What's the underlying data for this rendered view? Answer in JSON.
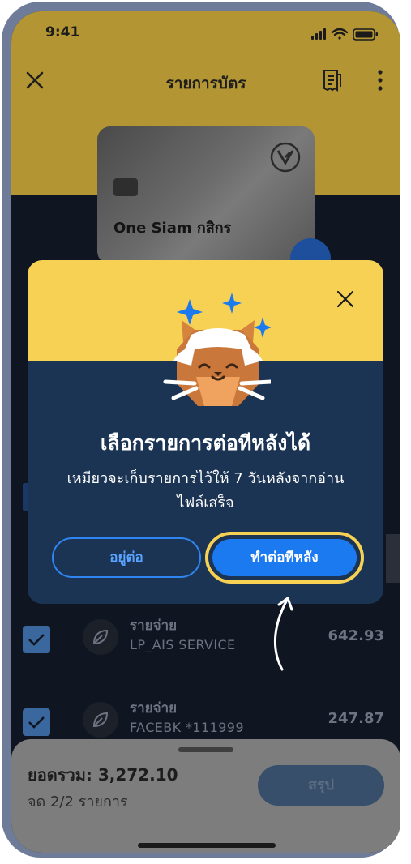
{
  "status_bar": {
    "time": "9:41"
  },
  "header": {
    "title": "รายการบัตร"
  },
  "card": {
    "name": "One Siam กสิกร"
  },
  "transactions": [
    {
      "type": "รายจ่าย",
      "merchant": "LP_AIS SERVICE",
      "amount": "642.93",
      "checked": true
    },
    {
      "type": "รายจ่าย",
      "merchant": "FACEBK *111999",
      "amount": "247.87",
      "checked": true
    }
  ],
  "summary": {
    "total_label": "ยอดรวม: 3,272.10",
    "count_label": "จด 2/2 รายการ",
    "button_label": "สรุป"
  },
  "modal": {
    "title": "เลือกรายการต่อทีหลังได้",
    "body": "เหมียวจะเก็บรายการไว้ให้ 7 วันหลังจากอ่านไฟล์เสร็จ",
    "secondary_button": "อยู่ต่อ",
    "primary_button": "ทำต่อทีหลัง"
  },
  "colors": {
    "accent_yellow": "#f7d154",
    "primary_blue": "#1c7af0",
    "modal_background": "#1b3454"
  }
}
